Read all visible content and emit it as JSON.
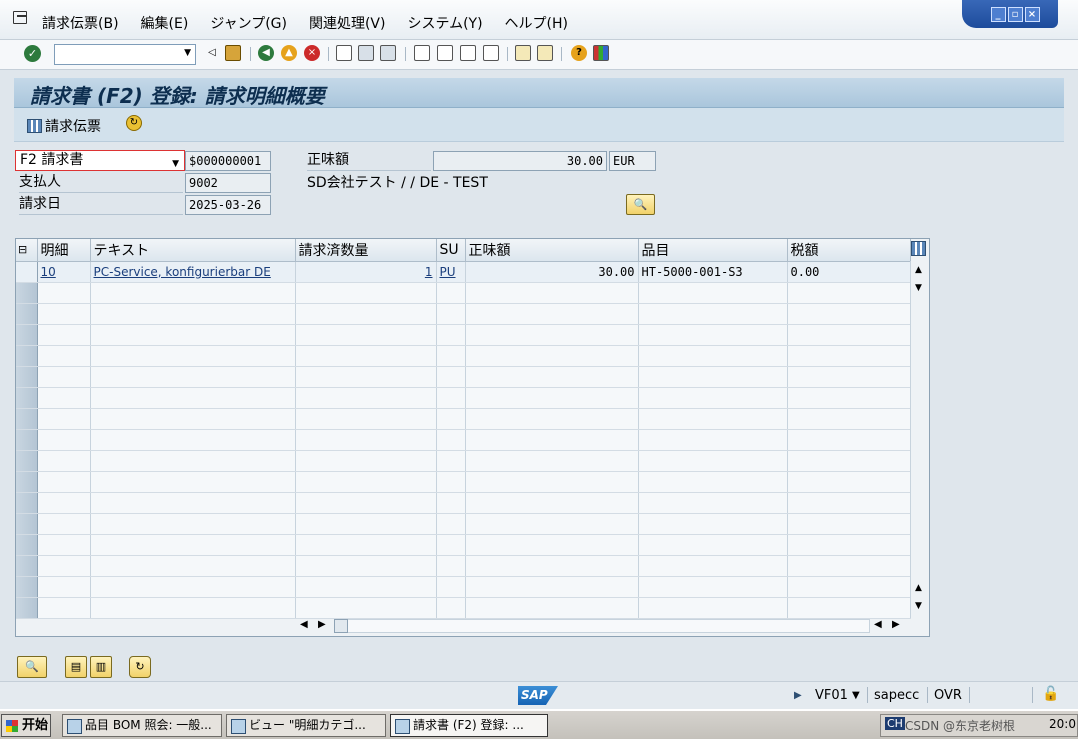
{
  "menu": {
    "items": [
      "請求伝票(B)",
      "編集(E)",
      "ジャンプ(G)",
      "関連処理(V)",
      "システム(Y)",
      "ヘルプ(H)"
    ]
  },
  "title": "請求書 (F2) 登録: 請求明細概要",
  "app_toolbar": {
    "document_button": "請求伝票"
  },
  "header": {
    "billing_type": "F2 請求書",
    "document_number": "$000000001",
    "net_value_label": "正味額",
    "net_value": "30.00",
    "currency": "EUR",
    "payer_label": "支払人",
    "payer": "9002",
    "payer_name": "SD会社テスト / / DE - TEST",
    "billing_date_label": "請求日",
    "billing_date": "2025-03-26"
  },
  "table": {
    "columns": [
      "明細",
      "テキスト",
      "請求済数量",
      "SU",
      "正味額",
      "品目",
      "税額"
    ],
    "rows": [
      [
        "10",
        "PC-Service, konfigurierbar DE",
        "1",
        "PU",
        "30.00",
        "HT-5000-001-S3",
        "0.00"
      ]
    ]
  },
  "statusbar": {
    "logo": "SAP",
    "transaction": "VF01",
    "server": "sapecc",
    "mode": "OVR"
  },
  "taskbar": {
    "start": "开始",
    "tasks": [
      "品目 BOM 照会: 一般...",
      "ビュー \"明細カテゴ...",
      "請求書 (F2) 登録: ..."
    ],
    "tray_clock": "20:0",
    "watermark": "CSDN @东京老树根"
  }
}
